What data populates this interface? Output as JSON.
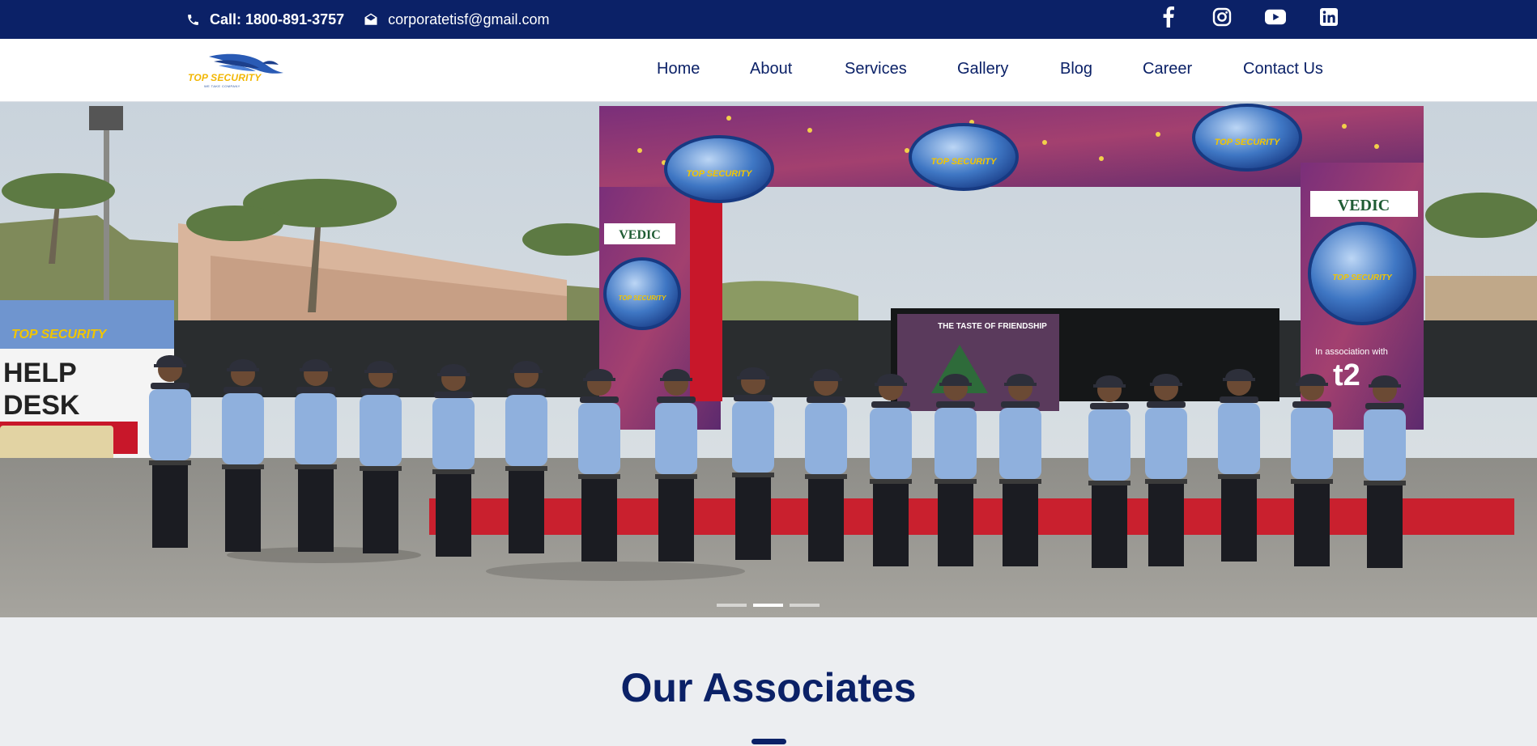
{
  "topbar": {
    "phone": "Call: 1800-891-3757",
    "email": "corporatetisf@gmail.com",
    "social_icons": [
      "facebook-icon",
      "instagram-icon",
      "youtube-icon",
      "linkedin-icon"
    ]
  },
  "logo": {
    "brand": "TOP SECURITY",
    "tagline": "WE TAKE COMPANY"
  },
  "nav": {
    "items": [
      "Home",
      "About",
      "Services",
      "Gallery",
      "Blog",
      "Career",
      "Contact Us"
    ]
  },
  "hero": {
    "slides": 3,
    "active_slide": 2,
    "banner_text": {
      "helpdesk_brand": "TOP SECURITY",
      "helpdesk_line1": "HELP",
      "helpdesk_line2": "DESK",
      "vedic": "VEDIC",
      "taste": "THE TASTE OF FRIENDSHIP",
      "association": "In association with",
      "t2": "t2",
      "badge_text": "TOP SECURITY"
    }
  },
  "associates": {
    "title": "Our Associates"
  },
  "colors": {
    "navy": "#0b2167",
    "gold": "#f2b705",
    "uniform_blue": "#8fb0dd"
  }
}
